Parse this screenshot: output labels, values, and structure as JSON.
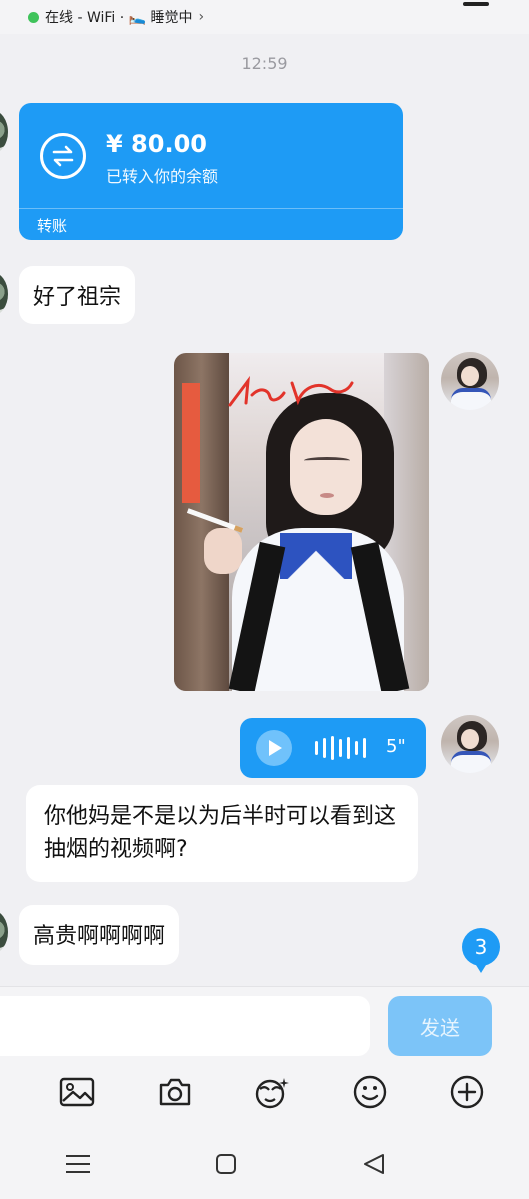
{
  "status_bar": {
    "presence": "在线 - WiFi · 🛌 睡觉中",
    "chevron": "›",
    "online_color": "#3fc35b"
  },
  "chat": {
    "timestamp": "12:59",
    "transfer": {
      "amount": "¥ 80.00",
      "subtitle": "已转入你的余额",
      "label": "转账",
      "icon": "transfer-arrows-icon",
      "color": "#1e9bf5"
    },
    "messages": [
      {
        "side": "left",
        "type": "text",
        "text": "好了祖宗"
      },
      {
        "side": "right",
        "type": "image",
        "content": "photo of a girl in school uniform holding a cigarette"
      },
      {
        "side": "right",
        "type": "voice",
        "duration": "5\""
      },
      {
        "side": "left",
        "type": "text",
        "text": "你他妈是不是以为后半时可以看到这抽烟的视频啊?"
      },
      {
        "side": "left",
        "type": "text",
        "text": "高贵啊啊啊啊"
      }
    ],
    "unread_count": "3"
  },
  "input": {
    "placeholder": "",
    "send_label": "发送"
  },
  "toolbar": {
    "icons": [
      "image-icon",
      "camera-icon",
      "sticker-icon",
      "emoji-icon",
      "plus-icon"
    ]
  },
  "navbar": {
    "icons": [
      "menu-icon",
      "home-icon",
      "back-icon"
    ]
  },
  "colors": {
    "accent": "#1e9bf5",
    "send_disabled": "#7cc4f8",
    "background": "#f0f0f3"
  }
}
